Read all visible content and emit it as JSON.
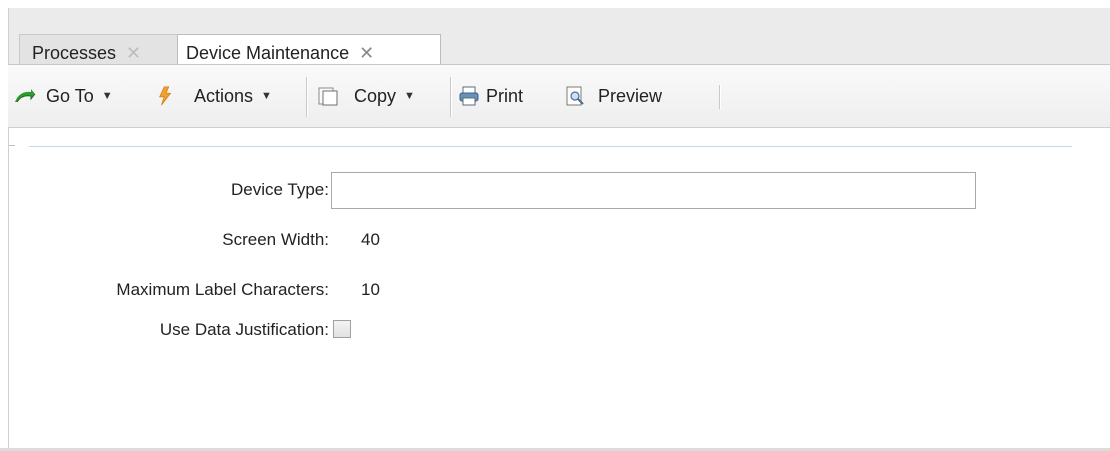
{
  "tabs": [
    {
      "label": "Processes",
      "close": "✕"
    },
    {
      "label": "Device Maintenance",
      "close": "✕"
    }
  ],
  "toolbar": {
    "goto_label": "Go To",
    "actions_label": "Actions",
    "copy_label": "Copy",
    "print_label": "Print",
    "preview_label": "Preview"
  },
  "form": {
    "device_type_label": "Device Type:",
    "device_type_value": "",
    "screen_width_label": "Screen Width:",
    "screen_width_value": "40",
    "max_label_chars_label": "Maximum Label Characters:",
    "max_label_chars_value": "10",
    "use_data_just_label": "Use Data Justification:",
    "use_data_just_checked": false
  },
  "icons": {
    "goto": "goto-arrow-icon",
    "actions": "lightning-icon",
    "copy": "copy-icon",
    "print": "printer-icon",
    "preview": "preview-icon"
  },
  "colors": {
    "accent_green": "#2e9b2e",
    "lightning_orange": "#f0a030"
  }
}
